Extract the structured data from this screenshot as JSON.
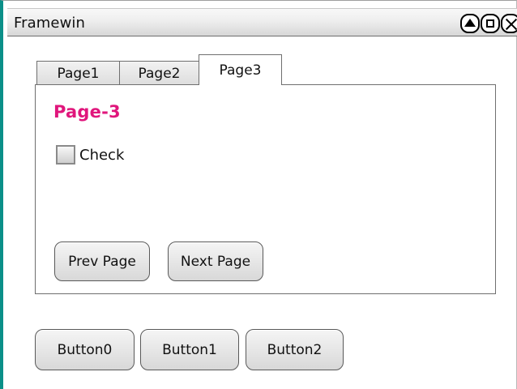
{
  "window": {
    "title": "Framewin"
  },
  "title_buttons": [
    {
      "icon": "triangle-up-icon"
    },
    {
      "icon": "maximize-icon"
    },
    {
      "icon": "close-icon"
    }
  ],
  "tabs": [
    {
      "label": "Page1",
      "selected": false
    },
    {
      "label": "Page2",
      "selected": false
    },
    {
      "label": "Page3",
      "selected": true
    }
  ],
  "page": {
    "heading": "Page-3",
    "heading_color": "#e0167c",
    "checkbox": {
      "label": "Check",
      "checked": false
    },
    "buttons": {
      "prev": "Prev Page",
      "next": "Next Page"
    }
  },
  "bottom_buttons": [
    {
      "label": "Button0"
    },
    {
      "label": "Button1"
    },
    {
      "label": "Button2"
    }
  ]
}
